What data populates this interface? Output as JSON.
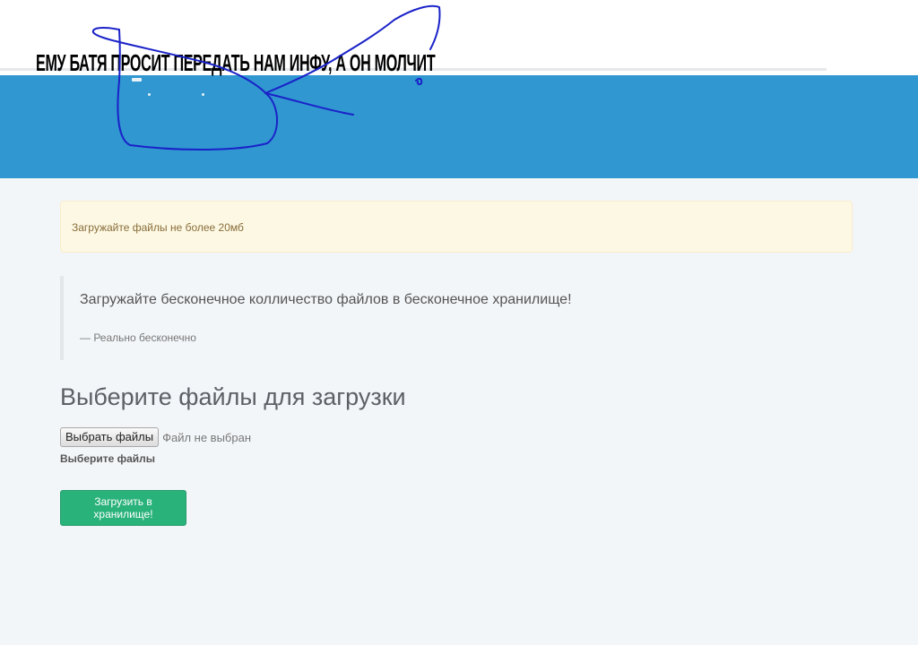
{
  "meme": {
    "caption": "ЕМУ БАТЯ ПРОСИТ ПЕРЕДАТЬ НАМ ИНФУ, А ОН МОЛЧИТ"
  },
  "alert": {
    "text": "Загружайте файлы не более 20мб",
    "color": "#fcf8e3"
  },
  "quote": {
    "text": "Загружайте бесконечное колличество файлов в бесконечное хранилище!",
    "footer": "—  Реально бесконечно"
  },
  "upload": {
    "title": "Выберите файлы для загрузки",
    "choose_button": "Выбрать файлы",
    "file_status": "Файл не выбран",
    "help_text": "Выберите файлы",
    "submit_button": "Загрузить в хранилище!"
  },
  "colors": {
    "header_blue": "#3097d1",
    "submit_green": "#2ab27b",
    "scribble_blue": "#1a22c8"
  }
}
